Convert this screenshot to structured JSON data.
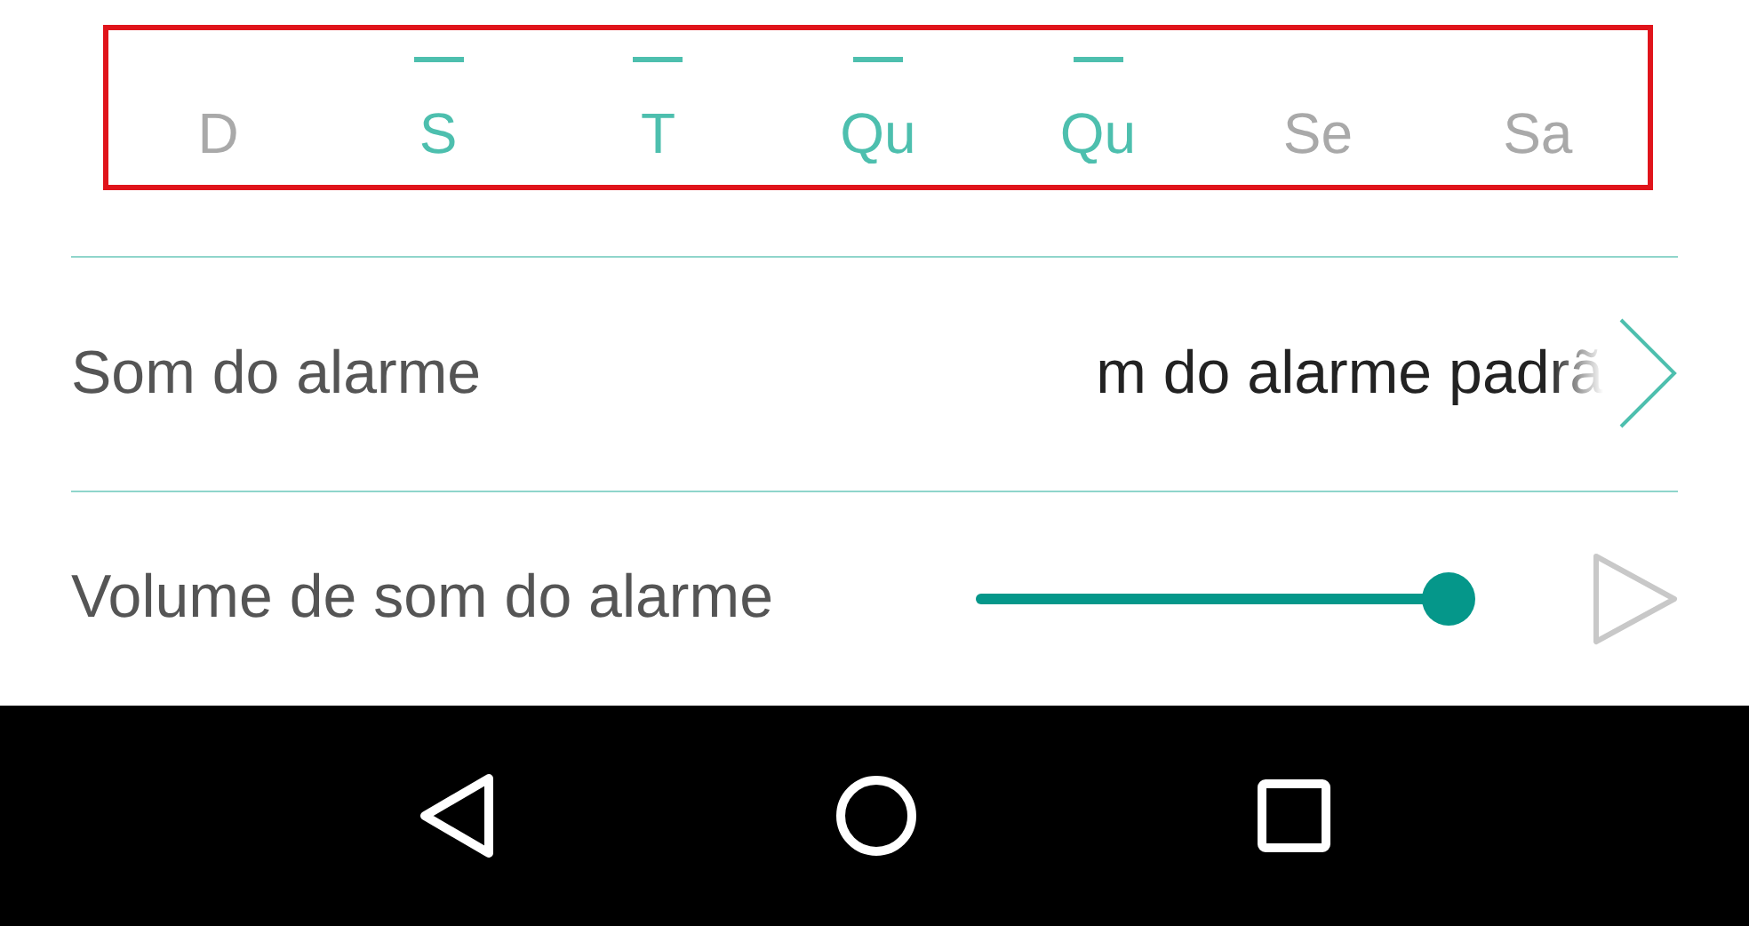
{
  "days": [
    {
      "label": "D",
      "selected": false
    },
    {
      "label": "S",
      "selected": true
    },
    {
      "label": "T",
      "selected": true
    },
    {
      "label": "Qu",
      "selected": true
    },
    {
      "label": "Qu",
      "selected": true
    },
    {
      "label": "Se",
      "selected": false
    },
    {
      "label": "Sa",
      "selected": false
    }
  ],
  "alarm_sound": {
    "label": "Som do alarme",
    "value": "m do alarme padrã"
  },
  "volume": {
    "label": "Volume de som do alarme",
    "level": 1
  }
}
